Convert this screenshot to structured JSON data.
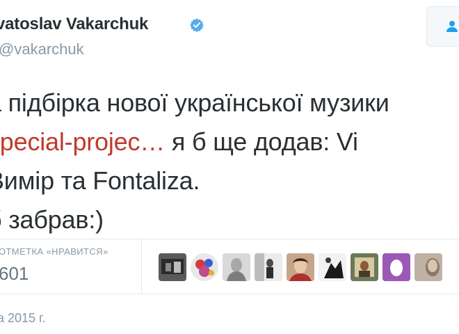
{
  "profile": {
    "name": "vatoslav Vakarchuk",
    "handle": "vakarchuk",
    "verified": true
  },
  "follow_button": {
    "icon": "follow-user-icon"
  },
  "tweet": {
    "line1": "а підбірка нової української музики",
    "line2_link": "special-projec…",
    "line2_rest": " я б ще додав: Vi",
    "line3": "Вимір та Fontaliza.",
    "line4": "б забрав:)"
  },
  "stats": {
    "likes_label": "ОТМЕТКА «НРАВИТСЯ»",
    "likes_count": "601"
  },
  "avatars": [
    "avatar-1",
    "avatar-2",
    "avatar-3",
    "avatar-4",
    "avatar-5",
    "avatar-6",
    "avatar-7",
    "avatar-8",
    "avatar-9",
    "avatar-10"
  ],
  "date": "а 2015 г.",
  "colors": {
    "text": "#292f33",
    "muted": "#8899a6",
    "link": "#c0392b",
    "verified": "#55acee",
    "border": "#e1e8ed"
  }
}
